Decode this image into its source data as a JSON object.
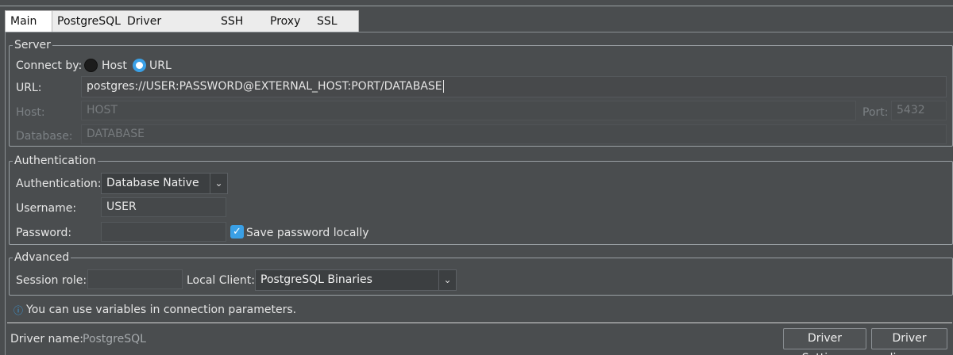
{
  "tabs": [
    "Main",
    "PostgreSQL",
    "Driver properties",
    "SSH",
    "Proxy",
    "SSL"
  ],
  "server": {
    "legend": "Server",
    "connect_by_label": "Connect by:",
    "host_option": "Host",
    "url_option": "URL",
    "url_label": "URL:",
    "url_value": "postgres://USER:PASSWORD@EXTERNAL_HOST:PORT/DATABASE",
    "host_label": "Host:",
    "host_placeholder": "HOST",
    "port_label": "Port:",
    "port_value": "5432",
    "database_label": "Database:",
    "database_placeholder": "DATABASE"
  },
  "auth": {
    "legend": "Authentication",
    "auth_label": "Authentication:",
    "auth_value": "Database Native",
    "username_label": "Username:",
    "username_value": "USER",
    "password_label": "Password:",
    "password_value": "",
    "save_password_label": "Save password locally",
    "save_password_checked": true
  },
  "advanced": {
    "legend": "Advanced",
    "session_role_label": "Session role:",
    "session_role_value": "",
    "local_client_label": "Local Client:",
    "local_client_value": "PostgreSQL Binaries"
  },
  "info_text": "You can use variables in connection parameters.",
  "footer": {
    "driver_name_label": "Driver name:",
    "driver_name_value": "PostgreSQL",
    "driver_settings_button": "Driver Settings",
    "driver_license_button": "Driver license"
  },
  "icons": {
    "info": "info-icon",
    "dropdown": "chevron-down-icon",
    "checkmark": "checkmark-icon"
  },
  "colors": {
    "accent": "#3aa0e6",
    "background": "#4a4d4f",
    "tab_bar": "#ececec"
  }
}
